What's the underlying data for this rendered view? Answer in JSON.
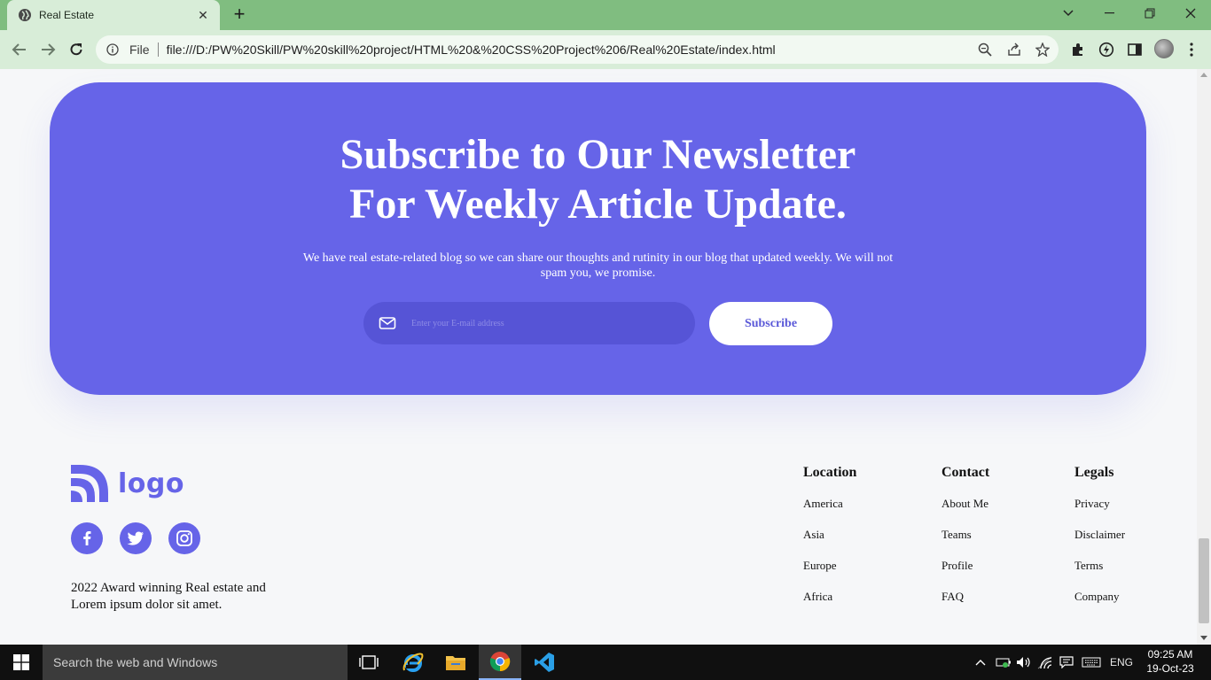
{
  "browser": {
    "tab_title": "Real Estate",
    "new_tab": "+",
    "address_prefix": "File",
    "url": "file:///D:/PW%20Skill/PW%20skill%20project/HTML%20&%20CSS%20Project%206/Real%20Estate/index.html"
  },
  "newsletter": {
    "title_line1": "Subscribe to Our Newsletter",
    "title_line2": "For Weekly Article Update.",
    "description": "We have real estate-related blog so we can share our thoughts and rutinity in our blog that updated weekly. We will not spam you, we promise.",
    "email_placeholder": "Enter your E-mail address",
    "subscribe_label": "Subscribe"
  },
  "footer": {
    "logo_text": "logo",
    "about": "2022 Award winning Real estate and Lorem ipsum dolor sit amet.",
    "socials": [
      "facebook-icon",
      "twitter-icon",
      "instagram-icon"
    ],
    "columns": [
      {
        "heading": "Location",
        "links": [
          "America",
          "Asia",
          "Europe",
          "Africa"
        ]
      },
      {
        "heading": "Contact",
        "links": [
          "About Me",
          "Teams",
          "Profile",
          "FAQ"
        ]
      },
      {
        "heading": "Legals",
        "links": [
          "Privacy",
          "Disclaimer",
          "Terms",
          "Company"
        ]
      }
    ]
  },
  "taskbar": {
    "search_placeholder": "Search the web and Windows",
    "language": "ENG",
    "time": "09:25 AM",
    "date": "19-Oct-23"
  },
  "colors": {
    "accent": "#6664e8",
    "tab_strip": "#80bd80",
    "toolbar": "#d8edd8"
  }
}
